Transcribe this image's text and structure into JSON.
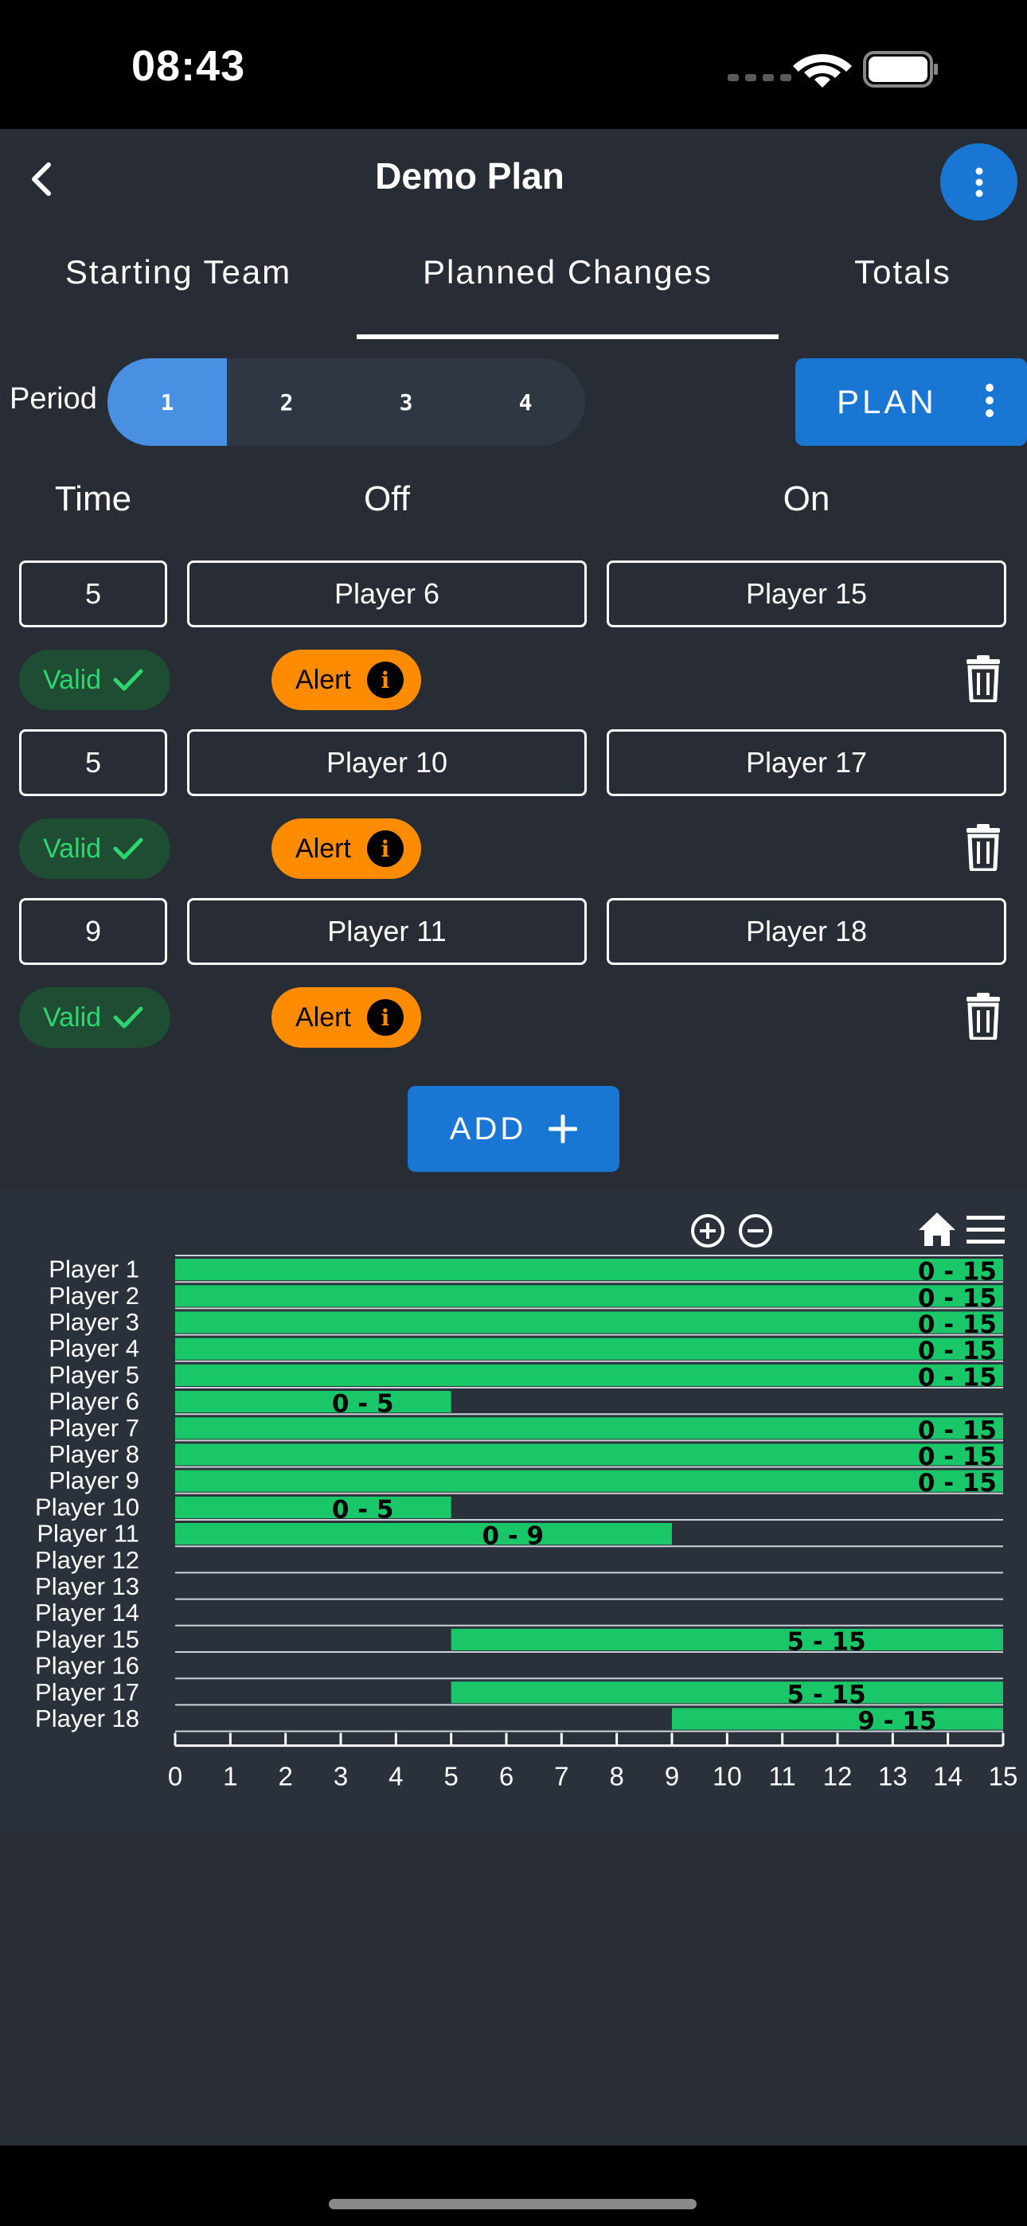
{
  "status_bar": {
    "time": "08:43"
  },
  "header": {
    "title": "Demo Plan"
  },
  "tabs": [
    {
      "label": "Starting Team",
      "active": false
    },
    {
      "label": "Planned Changes",
      "active": true
    },
    {
      "label": "Totals",
      "active": false
    }
  ],
  "period": {
    "label": "Period",
    "options": [
      "1",
      "2",
      "3",
      "4"
    ],
    "selected": "1"
  },
  "plan_button": {
    "label": "PLAN"
  },
  "columns": {
    "time": "Time",
    "off": "Off",
    "on": "On"
  },
  "changes": [
    {
      "time": "5",
      "off": "Player 6",
      "on": "Player 15",
      "valid_label": "Valid",
      "alert_label": "Alert"
    },
    {
      "time": "5",
      "off": "Player 10",
      "on": "Player 17",
      "valid_label": "Valid",
      "alert_label": "Alert"
    },
    {
      "time": "9",
      "off": "Player 11",
      "on": "Player 18",
      "valid_label": "Valid",
      "alert_label": "Alert"
    }
  ],
  "add_button": {
    "label": "ADD"
  },
  "colors": {
    "accent": "#1976d2",
    "bar": "#19c768",
    "valid": "#2fd670",
    "alert": "#ff8c00",
    "background": "#282c34"
  },
  "chart_data": {
    "type": "bar",
    "orientation": "horizontal-range",
    "categories": [
      "Player 1",
      "Player 2",
      "Player 3",
      "Player 4",
      "Player 5",
      "Player 6",
      "Player 7",
      "Player 8",
      "Player 9",
      "Player 10",
      "Player 11",
      "Player 12",
      "Player 13",
      "Player 14",
      "Player 15",
      "Player 16",
      "Player 17",
      "Player 18"
    ],
    "ranges": [
      [
        0,
        15
      ],
      [
        0,
        15
      ],
      [
        0,
        15
      ],
      [
        0,
        15
      ],
      [
        0,
        15
      ],
      [
        0,
        5
      ],
      [
        0,
        15
      ],
      [
        0,
        15
      ],
      [
        0,
        15
      ],
      [
        0,
        5
      ],
      [
        0,
        9
      ],
      null,
      null,
      null,
      [
        5,
        15
      ],
      null,
      [
        5,
        15
      ],
      [
        9,
        15
      ]
    ],
    "labels": [
      "0 - 15",
      "0 - 15",
      "0 - 15",
      "0 - 15",
      "0 - 15",
      "0 - 5",
      "0 - 15",
      "0 - 15",
      "0 - 15",
      "0 - 5",
      "0 - 9",
      "",
      "",
      "",
      "5 - 15",
      "",
      "5 - 15",
      "9 - 15"
    ],
    "xlim": [
      0,
      15
    ],
    "x_ticks": [
      "0",
      "1",
      "2",
      "3",
      "4",
      "5",
      "6",
      "7",
      "8",
      "9",
      "10",
      "11",
      "12",
      "13",
      "14",
      "15"
    ],
    "grid": true
  }
}
